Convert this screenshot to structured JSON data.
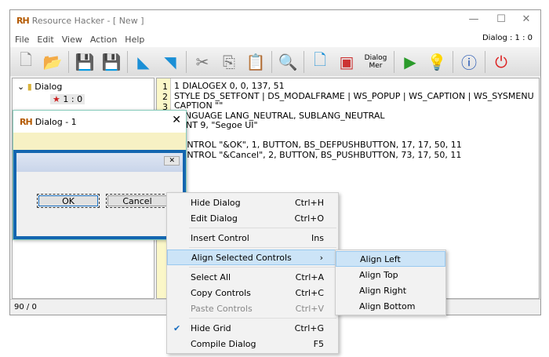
{
  "window": {
    "logo": "RH",
    "title": "Resource Hacker - [ New ]",
    "status_right": "Dialog : 1 : 0"
  },
  "menubar": [
    "File",
    "Edit",
    "View",
    "Action",
    "Help"
  ],
  "toolbar": {
    "dialog_menu_label": "Dialog Mer"
  },
  "tree": {
    "root": "Dialog",
    "child": "1 : 0"
  },
  "editor": {
    "line_numbers": [
      "1",
      "2",
      "3"
    ],
    "lines": [
      "1 DIALOGEX 0, 0, 137, 51",
      "STYLE DS_SETFONT | DS_MODALFRAME | WS_POPUP | WS_CAPTION | WS_SYSMENU",
      "CAPTION \"\"",
      "LANGUAGE LANG_NEUTRAL, SUBLANG_NEUTRAL",
      "FONT 9, \"Segoe UI\"",
      "",
      "CONTROL \"&OK\", 1, BUTTON, BS_DEFPUSHBUTTON, 17, 17, 50, 11",
      "CONTROL \"&Cancel\", 2, BUTTON, BS_PUSHBUTTON, 73, 17, 50, 11"
    ]
  },
  "statusbar": {
    "text": "90 / 0"
  },
  "dialog": {
    "title": "Dialog - 1",
    "ok": "OK",
    "cancel": "Cancel"
  },
  "context_menu": [
    {
      "label": "Hide Dialog",
      "shortcut": "Ctrl+H"
    },
    {
      "label": "Edit Dialog",
      "shortcut": "Ctrl+O"
    },
    {
      "label": "Insert Control",
      "shortcut": "Ins"
    },
    {
      "label": "Align Selected Controls",
      "shortcut": "›"
    },
    {
      "label": "Select All",
      "shortcut": "Ctrl+A"
    },
    {
      "label": "Copy Controls",
      "shortcut": "Ctrl+C"
    },
    {
      "label": "Paste Controls",
      "shortcut": "Ctrl+V"
    },
    {
      "label": "Hide Grid",
      "shortcut": "Ctrl+G",
      "checked": true
    },
    {
      "label": "Compile Dialog",
      "shortcut": "F5"
    }
  ],
  "submenu": [
    "Align Left",
    "Align Top",
    "Align Right",
    "Align Bottom"
  ]
}
